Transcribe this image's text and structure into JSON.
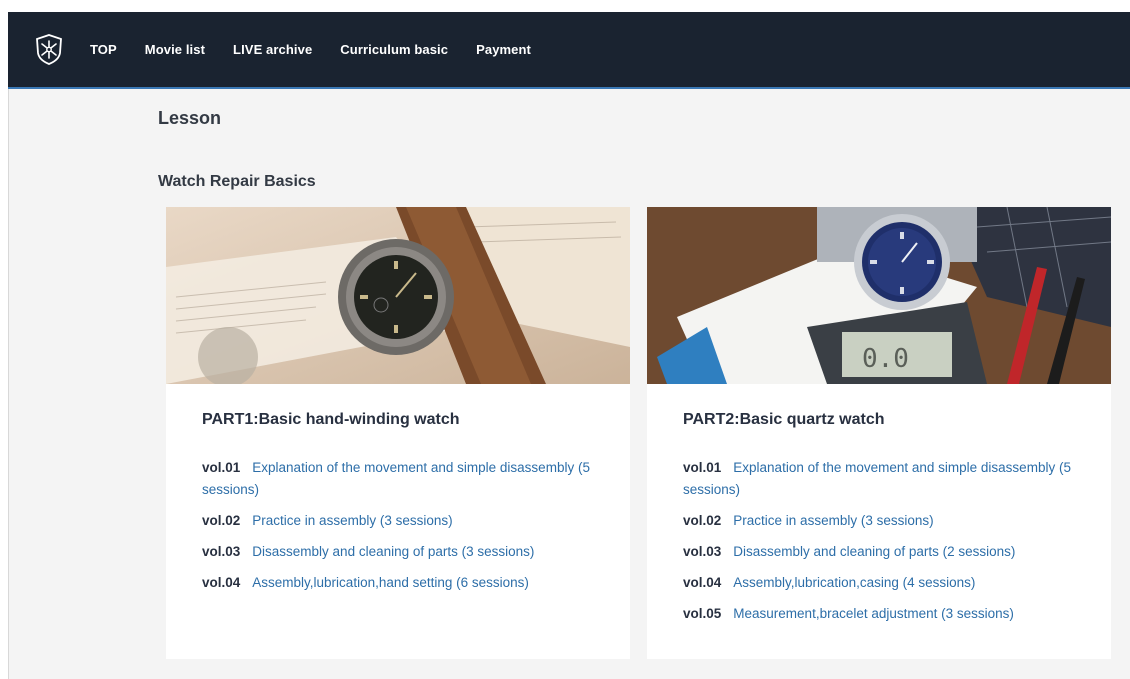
{
  "nav": {
    "items": [
      "TOP",
      "Movie list",
      "LIVE archive",
      "Curriculum basic",
      "Payment"
    ]
  },
  "page": {
    "title": "Lesson",
    "section_title": "Watch Repair Basics"
  },
  "cards": [
    {
      "title": "PART1:Basic hand-winding watch",
      "lessons": [
        {
          "vol": "vol.01",
          "text": "Explanation of the movement and simple disassembly (5 sessions)"
        },
        {
          "vol": "vol.02",
          "text": "Practice in assembly (3 sessions)"
        },
        {
          "vol": "vol.03",
          "text": "Disassembly and cleaning of parts (3 sessions)"
        },
        {
          "vol": "vol.04",
          "text": "Assembly,lubrication,hand setting (6 sessions)"
        }
      ]
    },
    {
      "title": "PART2:Basic quartz watch",
      "lessons": [
        {
          "vol": "vol.01",
          "text": "Explanation of the movement and simple disassembly (5 sessions)"
        },
        {
          "vol": "vol.02",
          "text": "Practice in assembly (3 sessions)"
        },
        {
          "vol": "vol.03",
          "text": "Disassembly and cleaning of parts (2 sessions)"
        },
        {
          "vol": "vol.04",
          "text": "Assembly,lubrication,casing (4 sessions)"
        },
        {
          "vol": "vol.05",
          "text": "Measurement,bracelet adjustment (3 sessions)"
        }
      ]
    }
  ],
  "icons": {
    "logo": "shield-star-logo-icon"
  },
  "colors": {
    "navbar": "#1a2330",
    "link": "#2d6ea8",
    "accent_line": "#3a78b5"
  }
}
